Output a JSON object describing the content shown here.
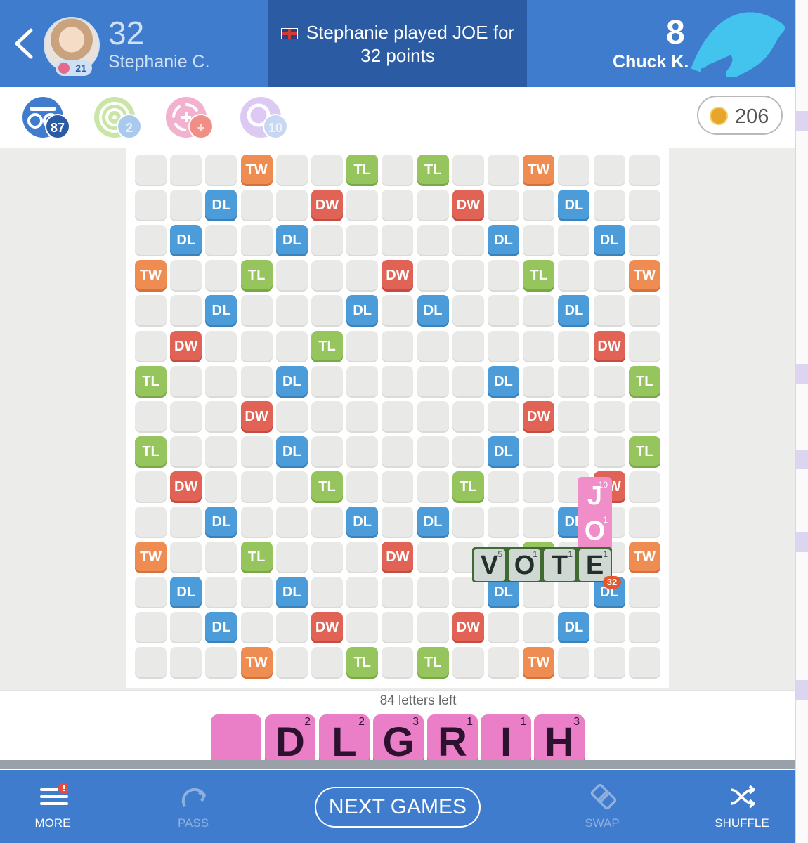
{
  "header": {
    "back_label": "back",
    "player1": {
      "score": "32",
      "name": "Stephanie C.",
      "level": "21"
    },
    "last_move": {
      "line1": "Stephanie played JOE for",
      "line2": "32 points"
    },
    "player2": {
      "score": "8",
      "name": "Chuck K."
    }
  },
  "powerups": [
    {
      "icon": "hindsight-icon",
      "count": "87",
      "color": "#3f7ccd"
    },
    {
      "icon": "radar-icon",
      "count": "2",
      "color": "#9fd06a"
    },
    {
      "icon": "swap-plus-icon",
      "count": "+",
      "color": "#e86a78"
    },
    {
      "icon": "word-meter-icon",
      "count": "10",
      "color": "#b89ae6"
    }
  ],
  "coins": {
    "value": "206"
  },
  "board": {
    "size": 15,
    "bonus_rows": [
      "...TW..TL.TL..TW...",
      "x"
    ],
    "bonus_grid": [
      [
        "",
        "",
        "",
        "TW",
        "",
        "",
        "TL",
        "",
        "TL",
        "",
        "",
        "TW",
        "",
        "",
        ""
      ],
      [
        "",
        "",
        "DL",
        "",
        "",
        "DW",
        "",
        "",
        "",
        "DW",
        "",
        "",
        "DL",
        "",
        ""
      ],
      [
        "",
        "DL",
        "",
        "",
        "DL",
        "",
        "",
        "",
        "",
        "",
        "DL",
        "",
        "",
        "DL",
        ""
      ],
      [
        "TW",
        "",
        "",
        "TL",
        "",
        "",
        "",
        "DW",
        "",
        "",
        "",
        "TL",
        "",
        "",
        "TW"
      ],
      [
        "",
        "",
        "DL",
        "",
        "",
        "",
        "DL",
        "",
        "DL",
        "",
        "",
        "",
        "DL",
        "",
        ""
      ],
      [
        "",
        "DW",
        "",
        "",
        "",
        "TL",
        "",
        "",
        "",
        "J",
        "",
        "",
        "",
        "DW",
        ""
      ],
      [
        "TL",
        "",
        "",
        "",
        "DL",
        "",
        "",
        "",
        "",
        "O",
        "DL",
        "",
        "",
        "",
        "TL"
      ],
      [
        "",
        "",
        "",
        "DW",
        "",
        "",
        "",
        "",
        "",
        "",
        "",
        "DW",
        "",
        "",
        ""
      ],
      [
        "TL",
        "",
        "",
        "",
        "DL",
        "",
        "",
        "",
        "",
        "",
        "DL",
        "",
        "",
        "",
        "TL"
      ],
      [
        "",
        "DW",
        "",
        "",
        "",
        "TL",
        "",
        "",
        "",
        "TL",
        "",
        "",
        "",
        "DW",
        ""
      ],
      [
        "",
        "",
        "DL",
        "",
        "",
        "",
        "DL",
        "",
        "DL",
        "",
        "",
        "",
        "DL",
        "",
        ""
      ],
      [
        "TW",
        "",
        "",
        "TL",
        "",
        "",
        "",
        "DW",
        "",
        "",
        "",
        "TL",
        "",
        "",
        "TW"
      ],
      [
        "",
        "DL",
        "",
        "",
        "DL",
        "",
        "",
        "",
        "",
        "",
        "DL",
        "",
        "",
        "DL",
        ""
      ],
      [
        "",
        "",
        "DL",
        "",
        "",
        "DW",
        "",
        "",
        "",
        "DW",
        "",
        "",
        "DL",
        "",
        ""
      ],
      [
        "",
        "",
        "",
        "TW",
        "",
        "",
        "TL",
        "",
        "TL",
        "",
        "",
        "TW",
        "",
        "",
        ""
      ]
    ],
    "played_joe": [
      {
        "letter": "J",
        "value": "10"
      },
      {
        "letter": "O",
        "value": "1"
      }
    ],
    "played_vote": [
      {
        "letter": "V",
        "value": "5"
      },
      {
        "letter": "O",
        "value": "1"
      },
      {
        "letter": "T",
        "value": "1"
      },
      {
        "letter": "E",
        "value": "1"
      }
    ],
    "move_score": "32"
  },
  "rack": {
    "letters_left": "84 letters left",
    "tiles": [
      {
        "letter": "",
        "value": ""
      },
      {
        "letter": "D",
        "value": "2"
      },
      {
        "letter": "L",
        "value": "2"
      },
      {
        "letter": "G",
        "value": "3"
      },
      {
        "letter": "R",
        "value": "1"
      },
      {
        "letter": "I",
        "value": "1"
      },
      {
        "letter": "H",
        "value": "3"
      }
    ]
  },
  "toolbar": {
    "more": "MORE",
    "pass": "PASS",
    "next_games": "NEXT GAMES",
    "swap": "SWAP",
    "shuffle": "SHUFFLE"
  }
}
